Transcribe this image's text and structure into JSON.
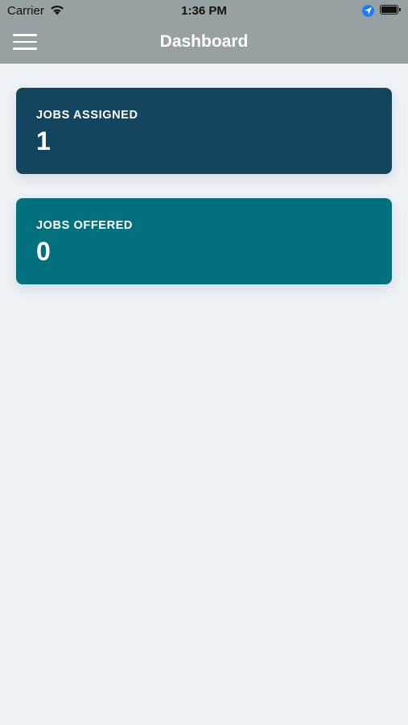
{
  "status_bar": {
    "carrier": "Carrier",
    "time": "1:36 PM",
    "icons": [
      "wifi-icon",
      "location-arrow-icon",
      "battery-icon"
    ]
  },
  "header": {
    "title": "Dashboard",
    "menu_icon": "hamburger-menu-icon",
    "background": "#97a0a3"
  },
  "cards": [
    {
      "label": "JOBS ASSIGNED",
      "value": "1",
      "color": "#14455e"
    },
    {
      "label": "JOBS OFFERED",
      "value": "0",
      "color": "#02717d"
    }
  ],
  "page": {
    "background": "#eef2f7"
  }
}
